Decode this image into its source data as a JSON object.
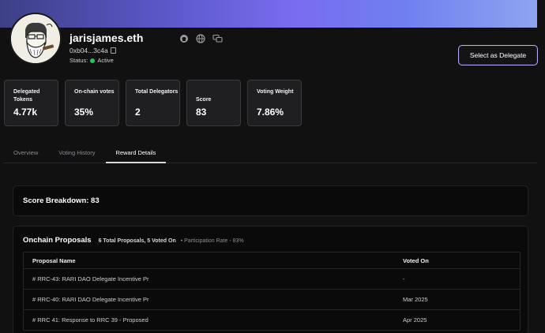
{
  "profile": {
    "name": "jarisjames.eth",
    "address": "0xb04...3c4a",
    "status_label": "Status:",
    "status_value": "Active",
    "socials": [
      "github-icon",
      "globe-icon",
      "chat-icon"
    ],
    "delegate_button": "Select as Delegate"
  },
  "stats": [
    {
      "label": "Delegated Tokens",
      "value": "4.77k"
    },
    {
      "label": "On-chain votes",
      "value": "35%"
    },
    {
      "label": "Total Delegators",
      "value": "2"
    },
    {
      "label": "Score",
      "value": "83"
    },
    {
      "label": "Voting Weight",
      "value": "7.86%"
    }
  ],
  "tabs": [
    {
      "label": "Overview",
      "active": false
    },
    {
      "label": "Voting History",
      "active": false
    },
    {
      "label": "Reward Details",
      "active": true
    }
  ],
  "score": {
    "title": "Score Breakdown: 83"
  },
  "proposals": {
    "title": "Onchain Proposals",
    "summary": "6 Total Proposals, 5 Voted On",
    "rate": "• Participation Rate - 83%",
    "columns": [
      "Proposal Name",
      "Voted On"
    ],
    "rows": [
      {
        "name": "# RRC-43: RARI DAO Delegate Incentive Pr",
        "voted": "-"
      },
      {
        "name": "# RRC-40: RARI DAO Delegate Incentive Pr",
        "voted": "Mar 2025"
      },
      {
        "name": "# RRC 41: Response to RRC 39 - Proposed",
        "voted": "Apr 2025"
      }
    ]
  },
  "colors": {
    "accent": "#b8a6f7",
    "active_dot": "#22c55e",
    "background": "#111112"
  }
}
